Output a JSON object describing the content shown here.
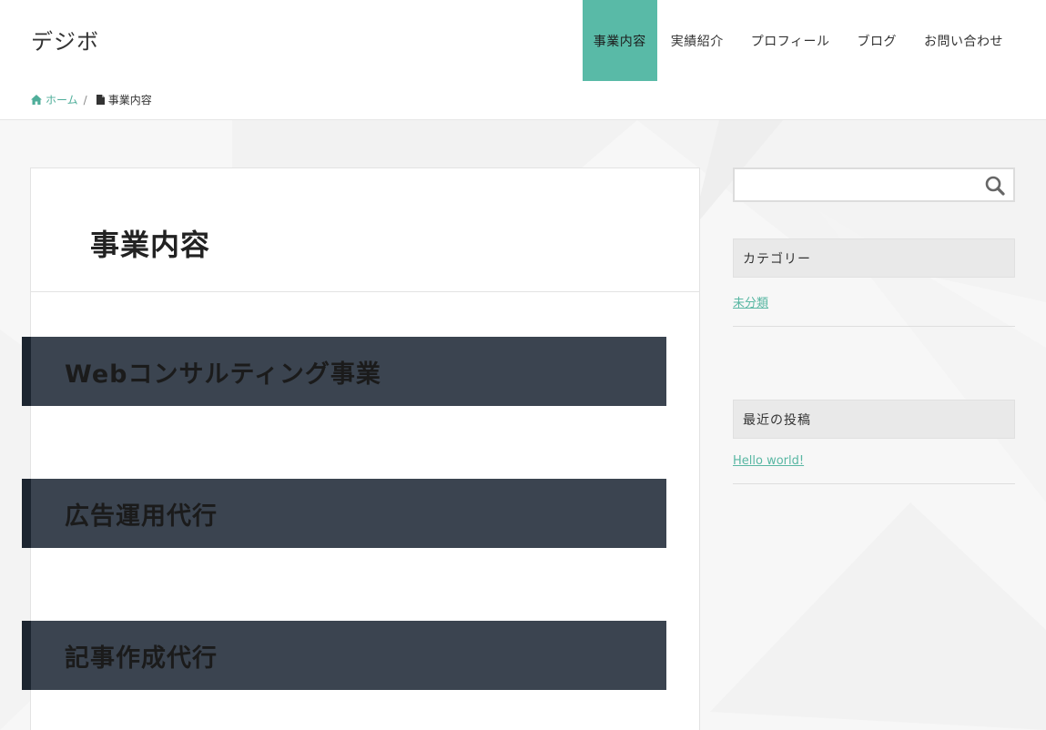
{
  "site": {
    "logo": "デジボ"
  },
  "nav": {
    "items": [
      {
        "label": "事業内容",
        "active": true
      },
      {
        "label": "実績紹介"
      },
      {
        "label": "プロフィール"
      },
      {
        "label": "ブログ"
      },
      {
        "label": "お問い合わせ"
      }
    ]
  },
  "breadcrumb": {
    "home": "ホーム",
    "separator": "/",
    "current": "事業内容"
  },
  "page": {
    "title": "事業内容",
    "sections": [
      {
        "heading": "Webコンサルティング事業"
      },
      {
        "heading": "広告運用代行"
      },
      {
        "heading": "記事作成代行"
      }
    ]
  },
  "sidebar": {
    "search": {
      "placeholder": "",
      "icon": "search-icon"
    },
    "categories": {
      "title": "カテゴリー",
      "links": [
        "未分類"
      ]
    },
    "recent_posts": {
      "title": "最近の投稿",
      "links": [
        "Hello world!"
      ]
    }
  },
  "colors": {
    "accent": "#59baa7",
    "heading_bg": "#3b4450",
    "heading_border": "#1c2530",
    "link": "#59b7a3"
  }
}
